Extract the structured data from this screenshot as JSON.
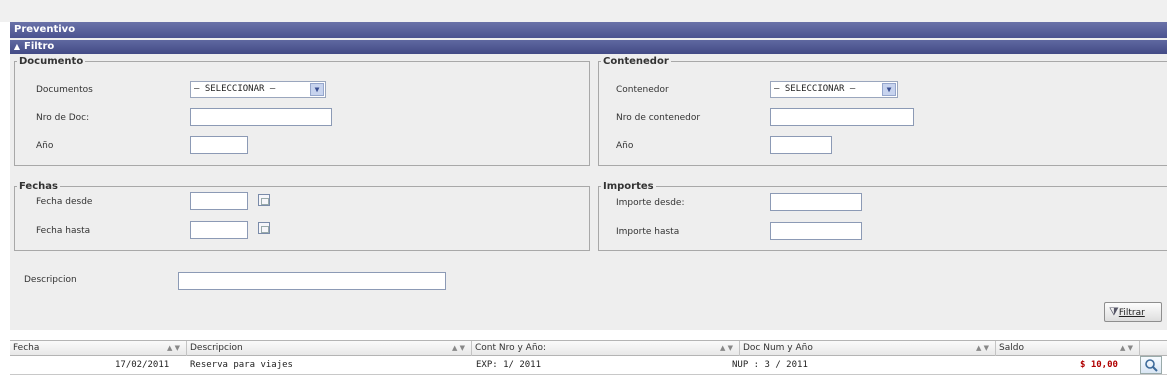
{
  "window": {
    "title": "Preventivo"
  },
  "filter": {
    "header": "Filtro",
    "documento": {
      "legend": "Documento",
      "documentos_label": "Documentos",
      "documentos_value": "— SELECCIONAR —",
      "nro_doc_label": "Nro de Doc:",
      "nro_doc_value": "",
      "anio_label": "Año",
      "anio_value": ""
    },
    "contenedor": {
      "legend": "Contenedor",
      "contenedor_label": "Contenedor",
      "contenedor_value": "— SELECCIONAR —",
      "nro_contenedor_label": "Nro de contenedor",
      "nro_contenedor_value": "",
      "anio_label": "Año",
      "anio_value": ""
    },
    "fechas": {
      "legend": "Fechas",
      "desde_label": "Fecha desde",
      "desde_value": "",
      "hasta_label": "Fecha hasta",
      "hasta_value": ""
    },
    "importes": {
      "legend": "Importes",
      "desde_label": "Importe desde:",
      "desde_value": "",
      "hasta_label": "Importe hasta",
      "hasta_value": ""
    },
    "descripcion_label": "Descripcion",
    "descripcion_value": "",
    "filtrar_label": "Filtrar"
  },
  "grid": {
    "columns": [
      "Fecha",
      "Descripcion",
      "Cont Nro y Año:",
      "Doc Num y Año",
      "Saldo"
    ],
    "rows": [
      {
        "fecha": "17/02/2011",
        "descripcion": "Reserva para viajes",
        "cont": "EXP: 1/ 2011",
        "doc": "NUP : 3 / 2011",
        "saldo": "$ 10,00"
      }
    ]
  },
  "icons": {
    "dropdown": "chevron-down-icon",
    "calendar": "calendar-icon",
    "filter": "funnel-icon",
    "view": "magnifier-icon",
    "collapse": "triangle-up-icon"
  }
}
